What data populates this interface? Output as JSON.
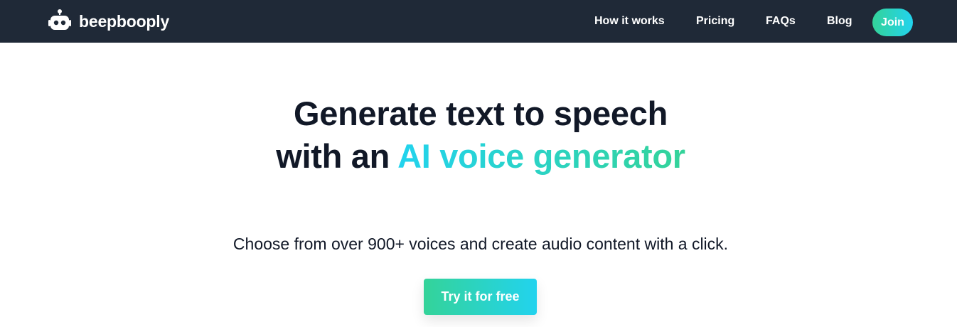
{
  "header": {
    "brand_name": "beepbooply",
    "logo_icon": "robot-icon",
    "nav": {
      "how_it_works": "How it works",
      "pricing": "Pricing",
      "faqs": "FAQs",
      "blog": "Blog"
    },
    "join_label": "Join"
  },
  "hero": {
    "title_line1": "Generate text to speech",
    "title_line2_prefix": "with an ",
    "title_line2_highlight": "AI voice generator",
    "subtitle": "Choose from over 900+ voices and create audio content with a click.",
    "cta_label": "Try it for free"
  },
  "colors": {
    "navbar_bg": "#1f2937",
    "text_dark": "#111827",
    "accent_cyan": "#22d3ee",
    "accent_green": "#34d399",
    "white": "#ffffff"
  }
}
